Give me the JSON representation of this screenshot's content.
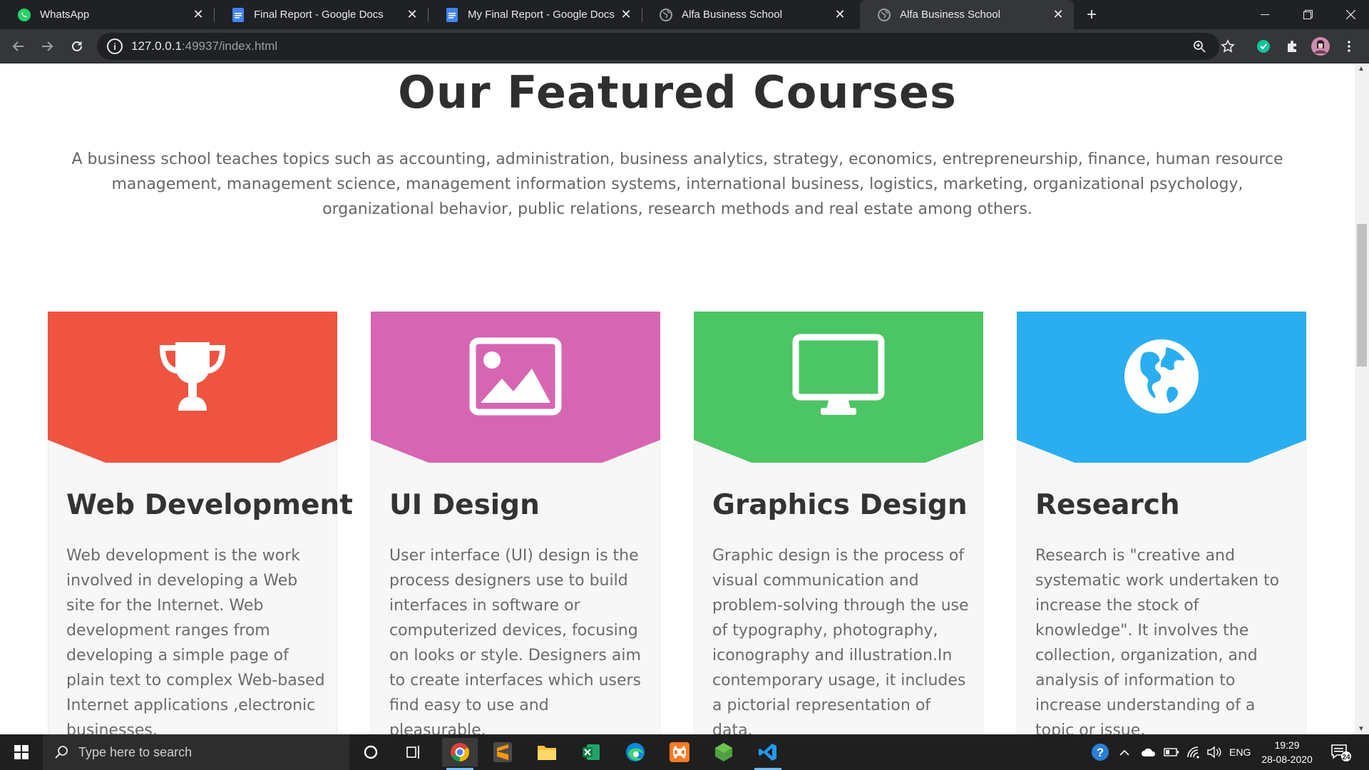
{
  "browser": {
    "tabs": [
      {
        "title": "WhatsApp",
        "icon": "whatsapp-icon",
        "active": false
      },
      {
        "title": "Final Report - Google Docs",
        "icon": "google-docs-icon",
        "active": false
      },
      {
        "title": "My Final Report - Google Docs",
        "icon": "google-docs-icon",
        "active": false
      },
      {
        "title": "Alfa Business School",
        "icon": "globe-icon",
        "active": false
      },
      {
        "title": "Alfa Business School",
        "icon": "globe-icon",
        "active": true
      }
    ],
    "url_host": "127.0.0.1",
    "url_rest": ":49937/index.html"
  },
  "page": {
    "title": "Our Featured Courses",
    "intro": "A business school teaches topics such as accounting, administration, business analytics, strategy, economics, entrepreneurship, finance, human resource management, management science, management information systems, international business, logistics, marketing, organizational psychology, organizational behavior, public relations, research methods and real estate among others.",
    "courses": [
      {
        "title": "Web Development",
        "color": "#ef5441",
        "icon": "trophy-icon",
        "text": "Web development is the work involved in developing a Web site for the Internet. Web development ranges from developing a simple page of plain text to complex Web-based Internet applications ,electronic businesses."
      },
      {
        "title": "UI Design",
        "color": "#d766b2",
        "icon": "image-icon",
        "text": "User interface (UI) design is the process designers use to build interfaces in software or computerized devices, focusing on looks or style. Designers aim to create interfaces which users find easy to use and pleasurable."
      },
      {
        "title": "Graphics Design",
        "color": "#4cc565",
        "icon": "desktop-icon",
        "text": "Graphic design is the process of visual communication and problem-solving through the use of typography, photography, iconography and illustration.In contemporary usage, it includes a pictorial representation of data."
      },
      {
        "title": "Research",
        "color": "#2aaef0",
        "icon": "globe-americas-icon",
        "text": "Research is \"creative and systematic work undertaken to increase the stock of knowledge\". It involves the collection, organization, and analysis of information to increase understanding of a topic or issue."
      }
    ]
  },
  "taskbar": {
    "search_placeholder": "Type here to search",
    "language": "ENG",
    "time": "19:29",
    "date": "28-08-2020",
    "notifications": "24"
  }
}
